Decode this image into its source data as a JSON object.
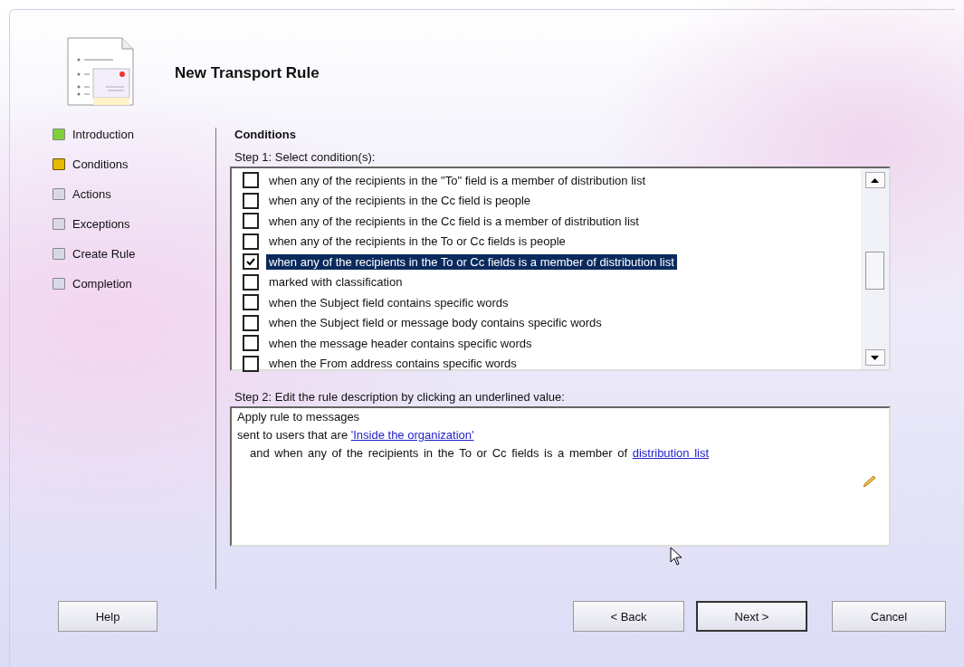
{
  "window": {
    "title": "New Transport Rule"
  },
  "steps": [
    {
      "label": "Introduction",
      "kind": "done"
    },
    {
      "label": "Conditions",
      "kind": "current"
    },
    {
      "label": "Actions",
      "kind": "pending"
    },
    {
      "label": "Exceptions",
      "kind": "pending"
    },
    {
      "label": "Create Rule",
      "kind": "pending"
    },
    {
      "label": "Completion",
      "kind": "pending"
    }
  ],
  "page": {
    "heading": "Conditions",
    "step1_label": "Step 1: Select condition(s):",
    "step2_label": "Step 2: Edit the rule description by clicking an underlined value:"
  },
  "conditions": [
    {
      "label": "when any of the recipients in the \"To\" field is a member of distribution list",
      "checked": false,
      "selected": false
    },
    {
      "label": "when any of the recipients in the Cc field is people",
      "checked": false,
      "selected": false
    },
    {
      "label": "when any of the recipients in the Cc field is a member of distribution list",
      "checked": false,
      "selected": false
    },
    {
      "label": "when any of the recipients in the To or Cc fields is people",
      "checked": false,
      "selected": false
    },
    {
      "label": "when any of the recipients in the To or Cc fields is a member of distribution list",
      "checked": true,
      "selected": true
    },
    {
      "label": "marked with classification",
      "checked": false,
      "selected": false
    },
    {
      "label": "when the Subject field contains specific words",
      "checked": false,
      "selected": false
    },
    {
      "label": "when the Subject field or message body contains specific words",
      "checked": false,
      "selected": false
    },
    {
      "label": "when the message header contains specific words",
      "checked": false,
      "selected": false
    },
    {
      "label": "when the From address contains specific words",
      "checked": false,
      "selected": false
    }
  ],
  "description": [
    {
      "kind": "plain",
      "parts": [
        {
          "text": "Apply rule to messages",
          "kind": "text"
        }
      ]
    },
    {
      "kind": "plain",
      "parts": [
        {
          "text": "sent to users that are ",
          "kind": "text"
        },
        {
          "text": "'Inside the organization'",
          "kind": "link"
        }
      ]
    },
    {
      "kind": "indented",
      "parts": [
        {
          "text": "and when any of the recipients in the To or Cc fields is a member of ",
          "kind": "text"
        },
        {
          "text": "distribution list",
          "kind": "link"
        }
      ]
    }
  ],
  "buttons": {
    "help": "Help",
    "back": "< Back",
    "next": "Next >",
    "cancel": "Cancel"
  }
}
